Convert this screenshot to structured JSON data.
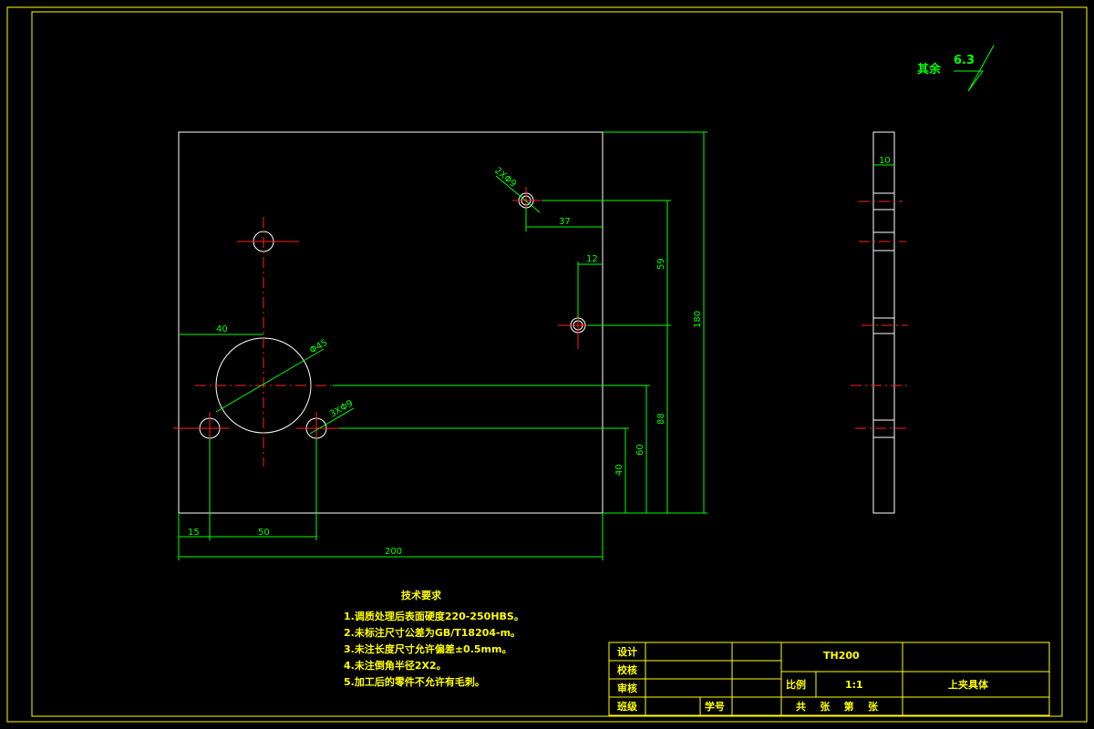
{
  "roughness": {
    "label": "其余",
    "value": "6.3"
  },
  "dimensions": {
    "width_total": "200",
    "hole_offset_x": "15",
    "hole_spacing": "50",
    "big_hole_x": "40",
    "big_hole_dia": "Φ45",
    "small_holes": "3XΦ9",
    "top_hole": "2XΦ9",
    "top_hole_offset": "37",
    "right_hole_offset": "12",
    "height_total": "180",
    "height_59": "59",
    "height_88": "88",
    "height_60": "60",
    "height_40": "40",
    "thickness": "10"
  },
  "tech_requirements": {
    "title": "技术要求",
    "items": [
      "1.调质处理后表面硬度220-250HBS。",
      "2.未标注尺寸公差为GB/T18204-m。",
      "3.未注长度尺寸允许偏差±0.5mm。",
      "4.未注倒角半径2X2。",
      "5.加工后的零件不允许有毛刺。"
    ]
  },
  "title_block": {
    "design": "设计",
    "check": "校核",
    "review": "审核",
    "class": "班级",
    "student_id": "学号",
    "code": "TH200",
    "scale_label": "比例",
    "scale_value": "1:1",
    "part_name": "上夹具体",
    "sheets": "共    张    第    张"
  },
  "colors": {
    "border": "#ffff00",
    "part": "#ffffff",
    "dimension": "#00ff00",
    "centerline": "#ff2020"
  }
}
